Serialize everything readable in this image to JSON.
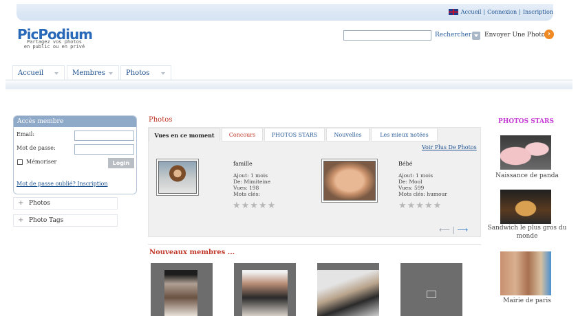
{
  "top_links": {
    "home": "Accueil",
    "login": "Connexion",
    "register": "Inscription",
    "sep": "|"
  },
  "logo": {
    "title": "PicPodium",
    "tagline_1": "Partagez vos photos",
    "tagline_2": "en public ou en privé"
  },
  "search": {
    "value": "",
    "button": "Rechercher"
  },
  "send_photo": {
    "label": "Envoyer Une Photo"
  },
  "nav": [
    {
      "label": "Accueil"
    },
    {
      "label": "Membres"
    },
    {
      "label": "Photos"
    }
  ],
  "member_box": {
    "title": "Accès membre",
    "email_label": "Email:",
    "password_label": "Mot de passe:",
    "remember_label": "Mémoriser",
    "login_button": "Login",
    "forgot_link": "Mot de passe oublié?",
    "register_link": "Inscription"
  },
  "sidebar": [
    {
      "label": "Photos"
    },
    {
      "label": "Photo Tags"
    }
  ],
  "photos_section": {
    "title": "Photos",
    "tabs": [
      {
        "label": "Vues en ce moment",
        "active": true
      },
      {
        "label": "Concours"
      },
      {
        "label": "PHOTOS STARS"
      },
      {
        "label": "Nouvelles"
      },
      {
        "label": "Les mieux notées"
      }
    ],
    "more_link": "Voir Plus De Photos",
    "items": [
      {
        "title": "famille",
        "added": "Ajout: 1 mois",
        "from": "De: Mimiteine",
        "views": "Vues: 198",
        "tags": "Mots clés:",
        "rating_stars": "★★★★★"
      },
      {
        "title": "Bébé",
        "added": "Ajout: 1 mois",
        "from": "De: Mool",
        "views": "Vues: 599",
        "tags": "Mots clés: humour",
        "rating_stars": "★★★★★"
      }
    ],
    "prev_arrow": "⟵",
    "divider": "|",
    "next_arrow": "⟶"
  },
  "new_members": {
    "title": "Nouveaux membres ..."
  },
  "stars": {
    "title": "PHOTOS STARS",
    "items": [
      {
        "caption": "Naissance de panda"
      },
      {
        "caption": "Sandwich le plus gros du monde"
      },
      {
        "caption": "Mairie de paris"
      }
    ]
  },
  "colors": {
    "accent_blue": "#2868b8",
    "accent_red": "#c0392b",
    "stars_pink": "#c53bd4",
    "orange": "#f08a24"
  }
}
